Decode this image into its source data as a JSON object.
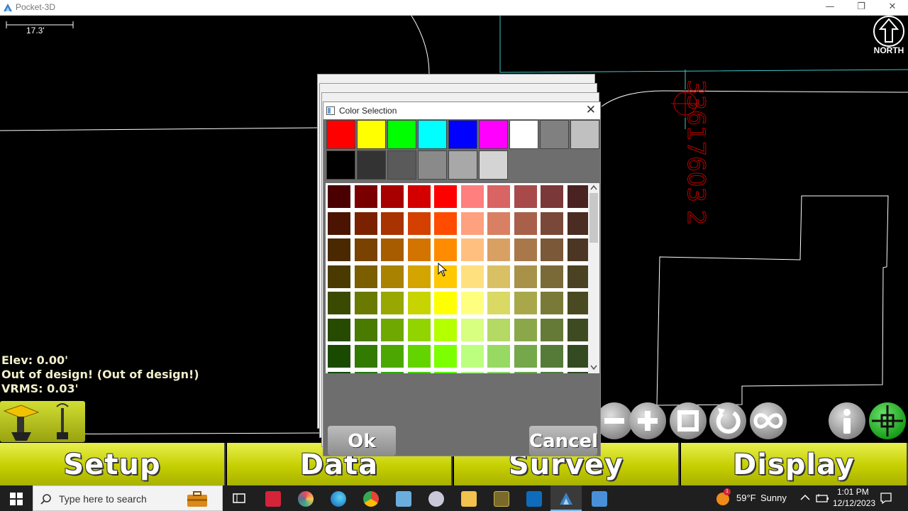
{
  "window": {
    "title": "Pocket-3D",
    "minimize": "—",
    "restore": "❐",
    "close": "✕"
  },
  "map": {
    "scale_label": "17.3'",
    "north_label": "NORTH",
    "red_label": "33617603 2"
  },
  "status": {
    "elev": "Elev: 0.00'",
    "design": "Out of design! (Out of design!)",
    "vrms": "VRMS: 0.03'"
  },
  "dialog": {
    "title": "Color Selection",
    "close": "✕",
    "ok_label": "Ok",
    "cancel_label": "Cancel",
    "basic_colors": [
      "#ff0000",
      "#ffff00",
      "#00ff00",
      "#00ffff",
      "#0000ff",
      "#ff00ff",
      "#ffffff",
      "#808080",
      "#c0c0c0"
    ],
    "gray_colors": [
      "#000000",
      "#333333",
      "#5a5a5a",
      "#8a8a8a",
      "#a8a8a8",
      "#d4d4d4"
    ],
    "grid_rows": [
      [
        "#4a0000",
        "#7a0000",
        "#a80000",
        "#d40000",
        "#ff0000",
        "#ff7f7f",
        "#d96464",
        "#a84a4a",
        "#7a3838",
        "#4a2222"
      ],
      [
        "#4a1400",
        "#7a2200",
        "#a83200",
        "#d44000",
        "#ff4c00",
        "#ffa07f",
        "#d98064",
        "#a8604a",
        "#7a4838",
        "#4a2c22"
      ],
      [
        "#4a2800",
        "#7a4200",
        "#a85c00",
        "#d47400",
        "#ff8c00",
        "#ffc07f",
        "#d9a064",
        "#a8784a",
        "#7a5838",
        "#4a3622"
      ],
      [
        "#4a3a00",
        "#7a5e00",
        "#a88200",
        "#d4a400",
        "#ffc800",
        "#ffe07f",
        "#d9c064",
        "#a8924a",
        "#7a6a38",
        "#4a4222"
      ],
      [
        "#3a4a00",
        "#6a7a00",
        "#98a800",
        "#c8d400",
        "#ffff00",
        "#ffff7f",
        "#d9d964",
        "#a8a84a",
        "#7a7a38",
        "#4a4a22"
      ],
      [
        "#264a00",
        "#4a7a00",
        "#6ea800",
        "#92d400",
        "#b4ff00",
        "#d8ff7f",
        "#b4d964",
        "#8aa84a",
        "#667a38",
        "#3e4a22"
      ],
      [
        "#1a4a00",
        "#327a00",
        "#4ca800",
        "#64d400",
        "#7cff00",
        "#bcff7f",
        "#98d964",
        "#74a84a",
        "#567a38",
        "#344a22"
      ],
      [
        "#0e4a00",
        "#1e7a00",
        "#2ea800",
        "#40d400",
        "#50ff00",
        "#a4ff7f",
        "#84d964",
        "#64a84a",
        "#4a7a38",
        "#2e4a22"
      ]
    ]
  },
  "nav": {
    "setup": "Setup",
    "data": "Data",
    "survey": "Survey",
    "display": "Display"
  },
  "taskbar": {
    "search_placeholder": "Type here to search",
    "weather_temp": "59°F",
    "weather_desc": "Sunny",
    "time": "1:01 PM",
    "date": "12/12/2023",
    "weather_badge": "1"
  }
}
